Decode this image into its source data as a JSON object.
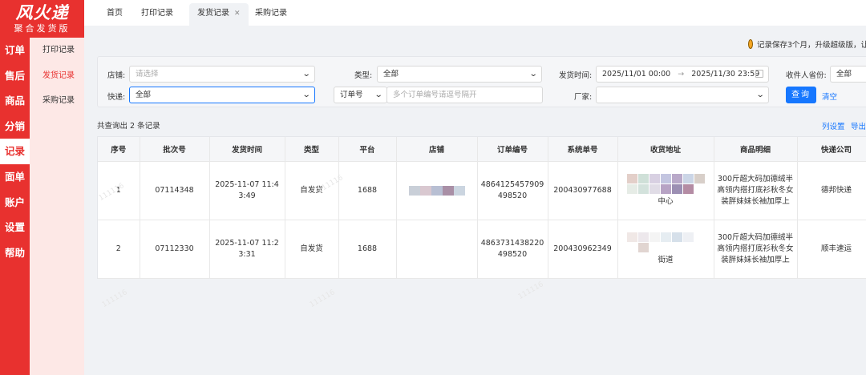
{
  "brand": {
    "logo": "风火递",
    "subtitle": "聚合发货版"
  },
  "rail": [
    "订单",
    "售后",
    "商品",
    "分销",
    "记录",
    "面单",
    "账户",
    "设置",
    "帮助"
  ],
  "submenu": [
    "打印记录",
    "发货记录",
    "采购记录"
  ],
  "tabs": [
    {
      "label": "首页"
    },
    {
      "label": "打印记录"
    },
    {
      "label": "发货记录",
      "close": "✕"
    },
    {
      "label": "采购记录"
    }
  ],
  "notice": "记录保存3个月，升级超级版，让",
  "filters": {
    "shop_label": "店铺:",
    "shop_value": "请选择",
    "type_label": "类型:",
    "type_value": "全部",
    "ship_time_label": "发货时间:",
    "date_from": "2025/11/01 00:00",
    "date_arrow": "→",
    "date_to": "2025/11/30 23:59",
    "province_label": "收件人省份:",
    "province_value": "全部",
    "express_label": "快递:",
    "express_value": "全部",
    "order_field": "订单号",
    "order_placeholder": "多个订单编号请逗号隔开",
    "factory_label": "厂家:",
    "factory_value": "",
    "query_btn": "查询",
    "clear_link": "清空"
  },
  "count_text": "共查询出 2 条记录",
  "links": {
    "col_settings": "列设置",
    "export": "导出"
  },
  "table": {
    "headers": [
      "序号",
      "批次号",
      "发货时间",
      "类型",
      "平台",
      "店铺",
      "订单编号",
      "系统单号",
      "收货地址",
      "商品明细",
      "快递公司"
    ],
    "rows": [
      {
        "seq": "1",
        "batch": "07114348",
        "time": "2025-11-07 11:43:49",
        "type": "自发货",
        "platform": "1688",
        "order": "4864125457909498520",
        "sys": "200430977688",
        "addr_tail": "中心",
        "goods": "300斤超大码加德绒半高领内搭打底衫秋冬女装胖妹妹长袖加厚上",
        "express": "德邦快递"
      },
      {
        "seq": "2",
        "batch": "07112330",
        "time": "2025-11-07 11:23:31",
        "type": "自发货",
        "platform": "1688",
        "order": "4863731438220498520",
        "sys": "200430962349",
        "addr_tail": "街道",
        "goods": "300斤超大码加德绒半高领内搭打底衫秋冬女装胖妹妹长袖加厚上",
        "express": "顺丰速运"
      }
    ]
  },
  "watermark": "111116",
  "colors": {
    "brand_red": "#e8312f",
    "submenu_bg": "#fde8e6",
    "primary_blue": "#1677ff"
  },
  "icons": {
    "notice": "smiley-face-icon",
    "select": "chevron-down-icon",
    "date": "calendar-icon",
    "close": "close-icon"
  }
}
